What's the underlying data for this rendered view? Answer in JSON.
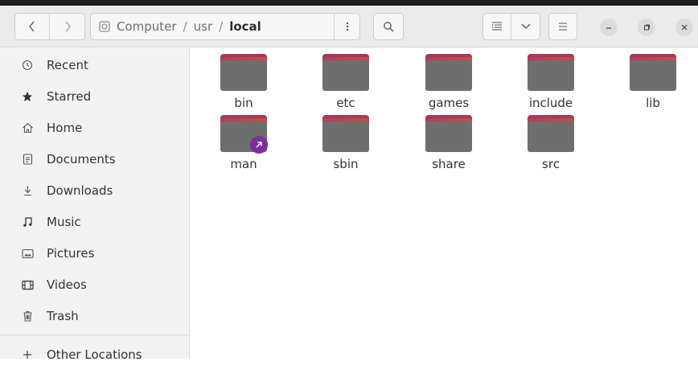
{
  "header": {
    "path": {
      "root_label": "Computer",
      "segments": [
        "usr",
        "local"
      ],
      "separator": "/"
    },
    "icons": {
      "back": "chevron-left-icon",
      "forward": "chevron-right-icon",
      "root": "disk-icon",
      "path_menu": "vertical-dots-icon",
      "search": "search-icon",
      "view_list": "list-view-icon",
      "view_options": "chevron-down-icon",
      "main_menu": "hamburger-icon",
      "minimize": "minimize-icon",
      "maximize": "maximize-icon",
      "close": "close-icon"
    }
  },
  "sidebar": {
    "items": [
      {
        "label": "Recent",
        "icon": "clock-icon"
      },
      {
        "label": "Starred",
        "icon": "star-icon"
      },
      {
        "label": "Home",
        "icon": "home-icon"
      },
      {
        "label": "Documents",
        "icon": "document-icon"
      },
      {
        "label": "Downloads",
        "icon": "download-icon"
      },
      {
        "label": "Music",
        "icon": "music-icon"
      },
      {
        "label": "Pictures",
        "icon": "picture-icon"
      },
      {
        "label": "Videos",
        "icon": "video-icon"
      },
      {
        "label": "Trash",
        "icon": "trash-icon"
      }
    ],
    "other_locations": {
      "label": "Other Locations",
      "icon": "plus-icon"
    }
  },
  "files": [
    {
      "name": "bin",
      "type": "folder"
    },
    {
      "name": "etc",
      "type": "folder"
    },
    {
      "name": "games",
      "type": "folder"
    },
    {
      "name": "include",
      "type": "folder"
    },
    {
      "name": "lib",
      "type": "folder"
    },
    {
      "name": "man",
      "type": "folder-link"
    },
    {
      "name": "sbin",
      "type": "folder"
    },
    {
      "name": "share",
      "type": "folder"
    },
    {
      "name": "src",
      "type": "folder"
    }
  ],
  "colors": {
    "folder_tab": "#a8385a",
    "folder_body": "#6e6e6e",
    "link_badge": "#7a2f9a"
  }
}
